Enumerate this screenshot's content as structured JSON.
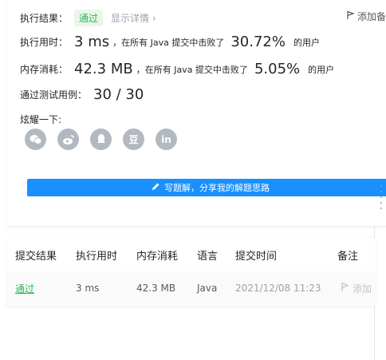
{
  "result": {
    "label": "执行结果：",
    "status": "通过",
    "details_link": "显示详情 ›",
    "add_note": "添加备"
  },
  "runtime": {
    "label": "执行用时：",
    "value": "3 ms",
    "mid_text": "，在所有 Java 提交中击败了",
    "percent": "30.72%",
    "suffix": "的用户"
  },
  "memory": {
    "label": "内存消耗：",
    "value": "42.3 MB",
    "mid_text": "，在所有 Java 提交中击败了",
    "percent": "5.05%",
    "suffix": "的用户"
  },
  "testcases": {
    "label": "通过测试用例：",
    "value": "30 / 30"
  },
  "share": {
    "label": "炫耀一下:",
    "icons": [
      "wechat-icon",
      "weibo-icon",
      "qq-icon",
      "douban-icon",
      "linkedin-icon"
    ],
    "douban_glyph": "豆",
    "linkedin_glyph": "in"
  },
  "write_button": {
    "label": "写题解，分享我的解题思路"
  },
  "table": {
    "headers": [
      "提交结果",
      "执行用时",
      "内存消耗",
      "语言",
      "提交时间",
      "备注"
    ],
    "rows": [
      {
        "status": "通过",
        "runtime": "3 ms",
        "memory": "42.3 MB",
        "language": "Java",
        "time": "2021/12/08 11:23",
        "note": "添加"
      }
    ]
  },
  "colors": {
    "accent": "#1a90ff",
    "success": "#2db55d",
    "muted": "#9aa3ad"
  }
}
